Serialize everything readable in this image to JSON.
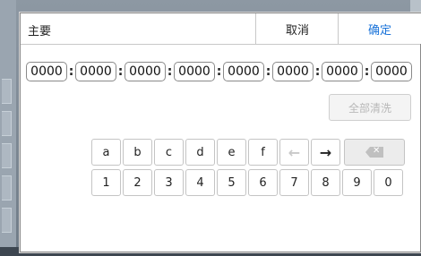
{
  "dialog": {
    "title": "主要",
    "cancel_label": "取消",
    "confirm_label": "确定"
  },
  "address": {
    "segments": [
      "0000",
      "0000",
      "0000",
      "0000",
      "0000",
      "0000",
      "0000",
      "0000"
    ],
    "separator": ":"
  },
  "clear_all_label": "全部清洗",
  "keyboard": {
    "row1": [
      "a",
      "b",
      "c",
      "d",
      "e",
      "f"
    ],
    "left_arrow_icon": "left-arrow-icon",
    "right_arrow_icon": "right-arrow-icon",
    "backspace_icon": "backspace-icon",
    "row2": [
      "1",
      "2",
      "3",
      "4",
      "5",
      "6",
      "7",
      "8",
      "9",
      "0"
    ]
  },
  "colors": {
    "accent": "#1a73d9",
    "disabled_text": "#b8b8b8"
  }
}
